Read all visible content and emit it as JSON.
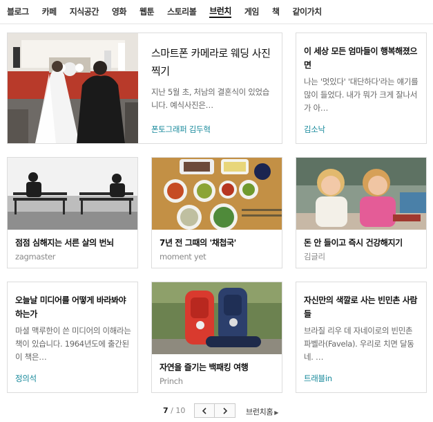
{
  "nav": {
    "items": [
      "블로그",
      "카페",
      "지식공간",
      "영화",
      "웹툰",
      "스토리볼",
      "브런치",
      "게임",
      "책",
      "같이가치"
    ],
    "active": "브런치"
  },
  "cards": [
    {
      "title": "스마트폰 카메라로 웨딩 사진 찍기",
      "desc": "지난 5월 초, 처남의 결혼식이 있었습니다. 예식사진은…",
      "author": "폰토그래퍼 김두혁",
      "author_style": "link",
      "image": "wedding-photo"
    },
    {
      "title": "이 세상 모든 엄마들이 행복해졌으면",
      "desc": "나는 '멋있다' '대단하다'라는 얘기를 많이 들었다. 내가 뭐가 크게 잘나서가 아…",
      "author": "김소낙",
      "author_style": "link"
    },
    {
      "title": "점점 심해지는 서른 살의 번뇌",
      "author": "zagmaster",
      "author_style": "plain",
      "image": "bench-photo"
    },
    {
      "title": "7년 전 그때의 '채첩국'",
      "author": "moment yet",
      "author_style": "plain",
      "image": "korean-food-photo"
    },
    {
      "title": "돈 안 들이고 즉시 건강해지기",
      "author": "김글리",
      "author_style": "plain",
      "image": "kids-laughing-photo"
    },
    {
      "title": "오늘날 미디어를 어떻게 바라봐야 하는가",
      "desc": "마셜 맥루한이 쓴 미디어의 이해라는 책이 있습니다. 1964년도에 출간된 이 책은…",
      "author": "정의석",
      "author_style": "link"
    },
    {
      "title": "자연을 즐기는 백패킹 여행",
      "author": "Princh",
      "author_style": "plain",
      "image": "backpacks-photo"
    },
    {
      "title": "자신만의 색깔로 사는 빈민촌 사람들",
      "desc": "브라질 리우 데 자네이로의 빈민촌 파벨라(Favela). 우리로 치면 달동네. …",
      "author": "트래블in",
      "author_style": "link"
    }
  ],
  "pagination": {
    "current": "7",
    "separator": " / ",
    "total": "10",
    "prev_icon": "chevron-left-icon",
    "next_icon": "chevron-right-icon",
    "home_label": "브런치홈",
    "home_icon": "caret-right-icon"
  },
  "colors": {
    "author_link": "#17899b",
    "author_plain": "#888888",
    "border": "#dcdcdc"
  }
}
